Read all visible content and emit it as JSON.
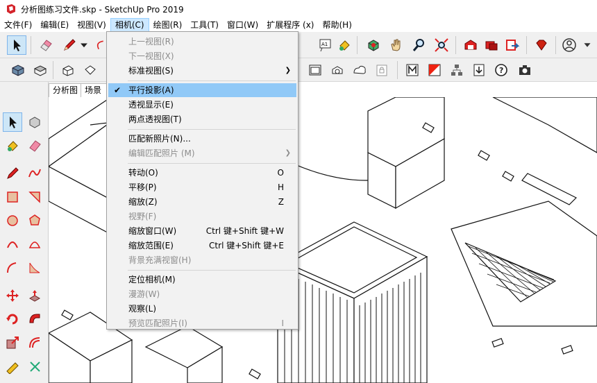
{
  "window": {
    "title": "分析图练习文件.skp - SketchUp Pro 2019",
    "app_icon": "sketchup-logo-icon"
  },
  "menubar": [
    {
      "label": "文件(F)"
    },
    {
      "label": "编辑(E)"
    },
    {
      "label": "视图(V)"
    },
    {
      "label": "相机(C)",
      "active": true
    },
    {
      "label": "绘图(R)"
    },
    {
      "label": "工具(T)"
    },
    {
      "label": "窗口(W)"
    },
    {
      "label": "扩展程序 (x)"
    },
    {
      "label": "帮助(H)"
    }
  ],
  "camera_menu": {
    "items": [
      {
        "label": "上一视图(R)",
        "disabled": true
      },
      {
        "label": "下一视图(X)",
        "disabled": true
      },
      {
        "label": "标准视图(S)",
        "submenu": true
      },
      {
        "sep": true
      },
      {
        "label": "平行投影(A)",
        "checked": true,
        "highlighted": true
      },
      {
        "label": "透视显示(E)"
      },
      {
        "label": "两点透视图(T)"
      },
      {
        "sep": true
      },
      {
        "label": "匹配新照片(N)..."
      },
      {
        "label": "编辑匹配照片 (M)",
        "disabled": true,
        "submenu": true
      },
      {
        "sep": true
      },
      {
        "label": "转动(O)",
        "shortcut": "O"
      },
      {
        "label": "平移(P)",
        "shortcut": "H"
      },
      {
        "label": "缩放(Z)",
        "shortcut": "Z"
      },
      {
        "label": "视野(F)",
        "disabled": true
      },
      {
        "label": "缩放窗口(W)",
        "shortcut": "Ctrl 键+Shift 键+W"
      },
      {
        "label": "缩放范围(E)",
        "shortcut": "Ctrl 键+Shift 键+E"
      },
      {
        "label": "背景充满视窗(H)",
        "disabled": true
      },
      {
        "sep": true
      },
      {
        "label": "定位相机(M)"
      },
      {
        "label": "漫游(W)",
        "disabled": true
      },
      {
        "label": "观察(L)"
      },
      {
        "label": "预览匹配照片(I)",
        "disabled": true,
        "shortcut": "I"
      }
    ]
  },
  "scene_tabs": [
    {
      "label": "分析图"
    },
    {
      "label": "场景号"
    }
  ],
  "toolbar_top": [
    "select-arrow-icon",
    "eraser-icon",
    "pencil-icon",
    "dropdown-arrow-icon",
    "text-label-icon",
    "paint-bucket-icon",
    "component-icon",
    "orbit-hand-icon",
    "zoom-icon",
    "zoom-extents-icon",
    "warehouse-icon",
    "extension-warehouse-icon",
    "send-layout-icon",
    "ruby-gem-icon",
    "user-account-icon",
    "more-icon"
  ],
  "toolbar_second": [
    "iso-view-icon",
    "top-view-icon",
    "front-view-icon",
    "right-view-icon",
    "back-view-icon",
    "left-view-icon",
    "section-plane-icon",
    "section-display-icon",
    "section-cut-icon",
    "lock-icon",
    "material-m-icon",
    "color-red-icon",
    "hierarchy-icon",
    "download-icon",
    "help-icon",
    "camera-icon"
  ],
  "toolbar_left": [
    "select-arrow-icon",
    "component-icon",
    "paint-bucket-icon",
    "eraser-icon",
    "pencil-icon",
    "freehand-icon",
    "rectangle-icon",
    "rotated-rect-icon",
    "circle-icon",
    "polygon-icon",
    "arc-icon",
    "pie-arc-icon",
    "two-point-arc-icon",
    "three-point-arc-icon",
    "move-icon",
    "push-pull-icon",
    "rotate-icon",
    "follow-me-icon",
    "scale-icon",
    "offset-icon",
    "tape-measure-icon",
    "axes-icon"
  ],
  "colors": {
    "menu_highlight": "#91c9f7",
    "menubar_active": "#cce8ff",
    "disabled_text": "#8c8c8c",
    "toolbar_bg": "#f0f0f0"
  }
}
